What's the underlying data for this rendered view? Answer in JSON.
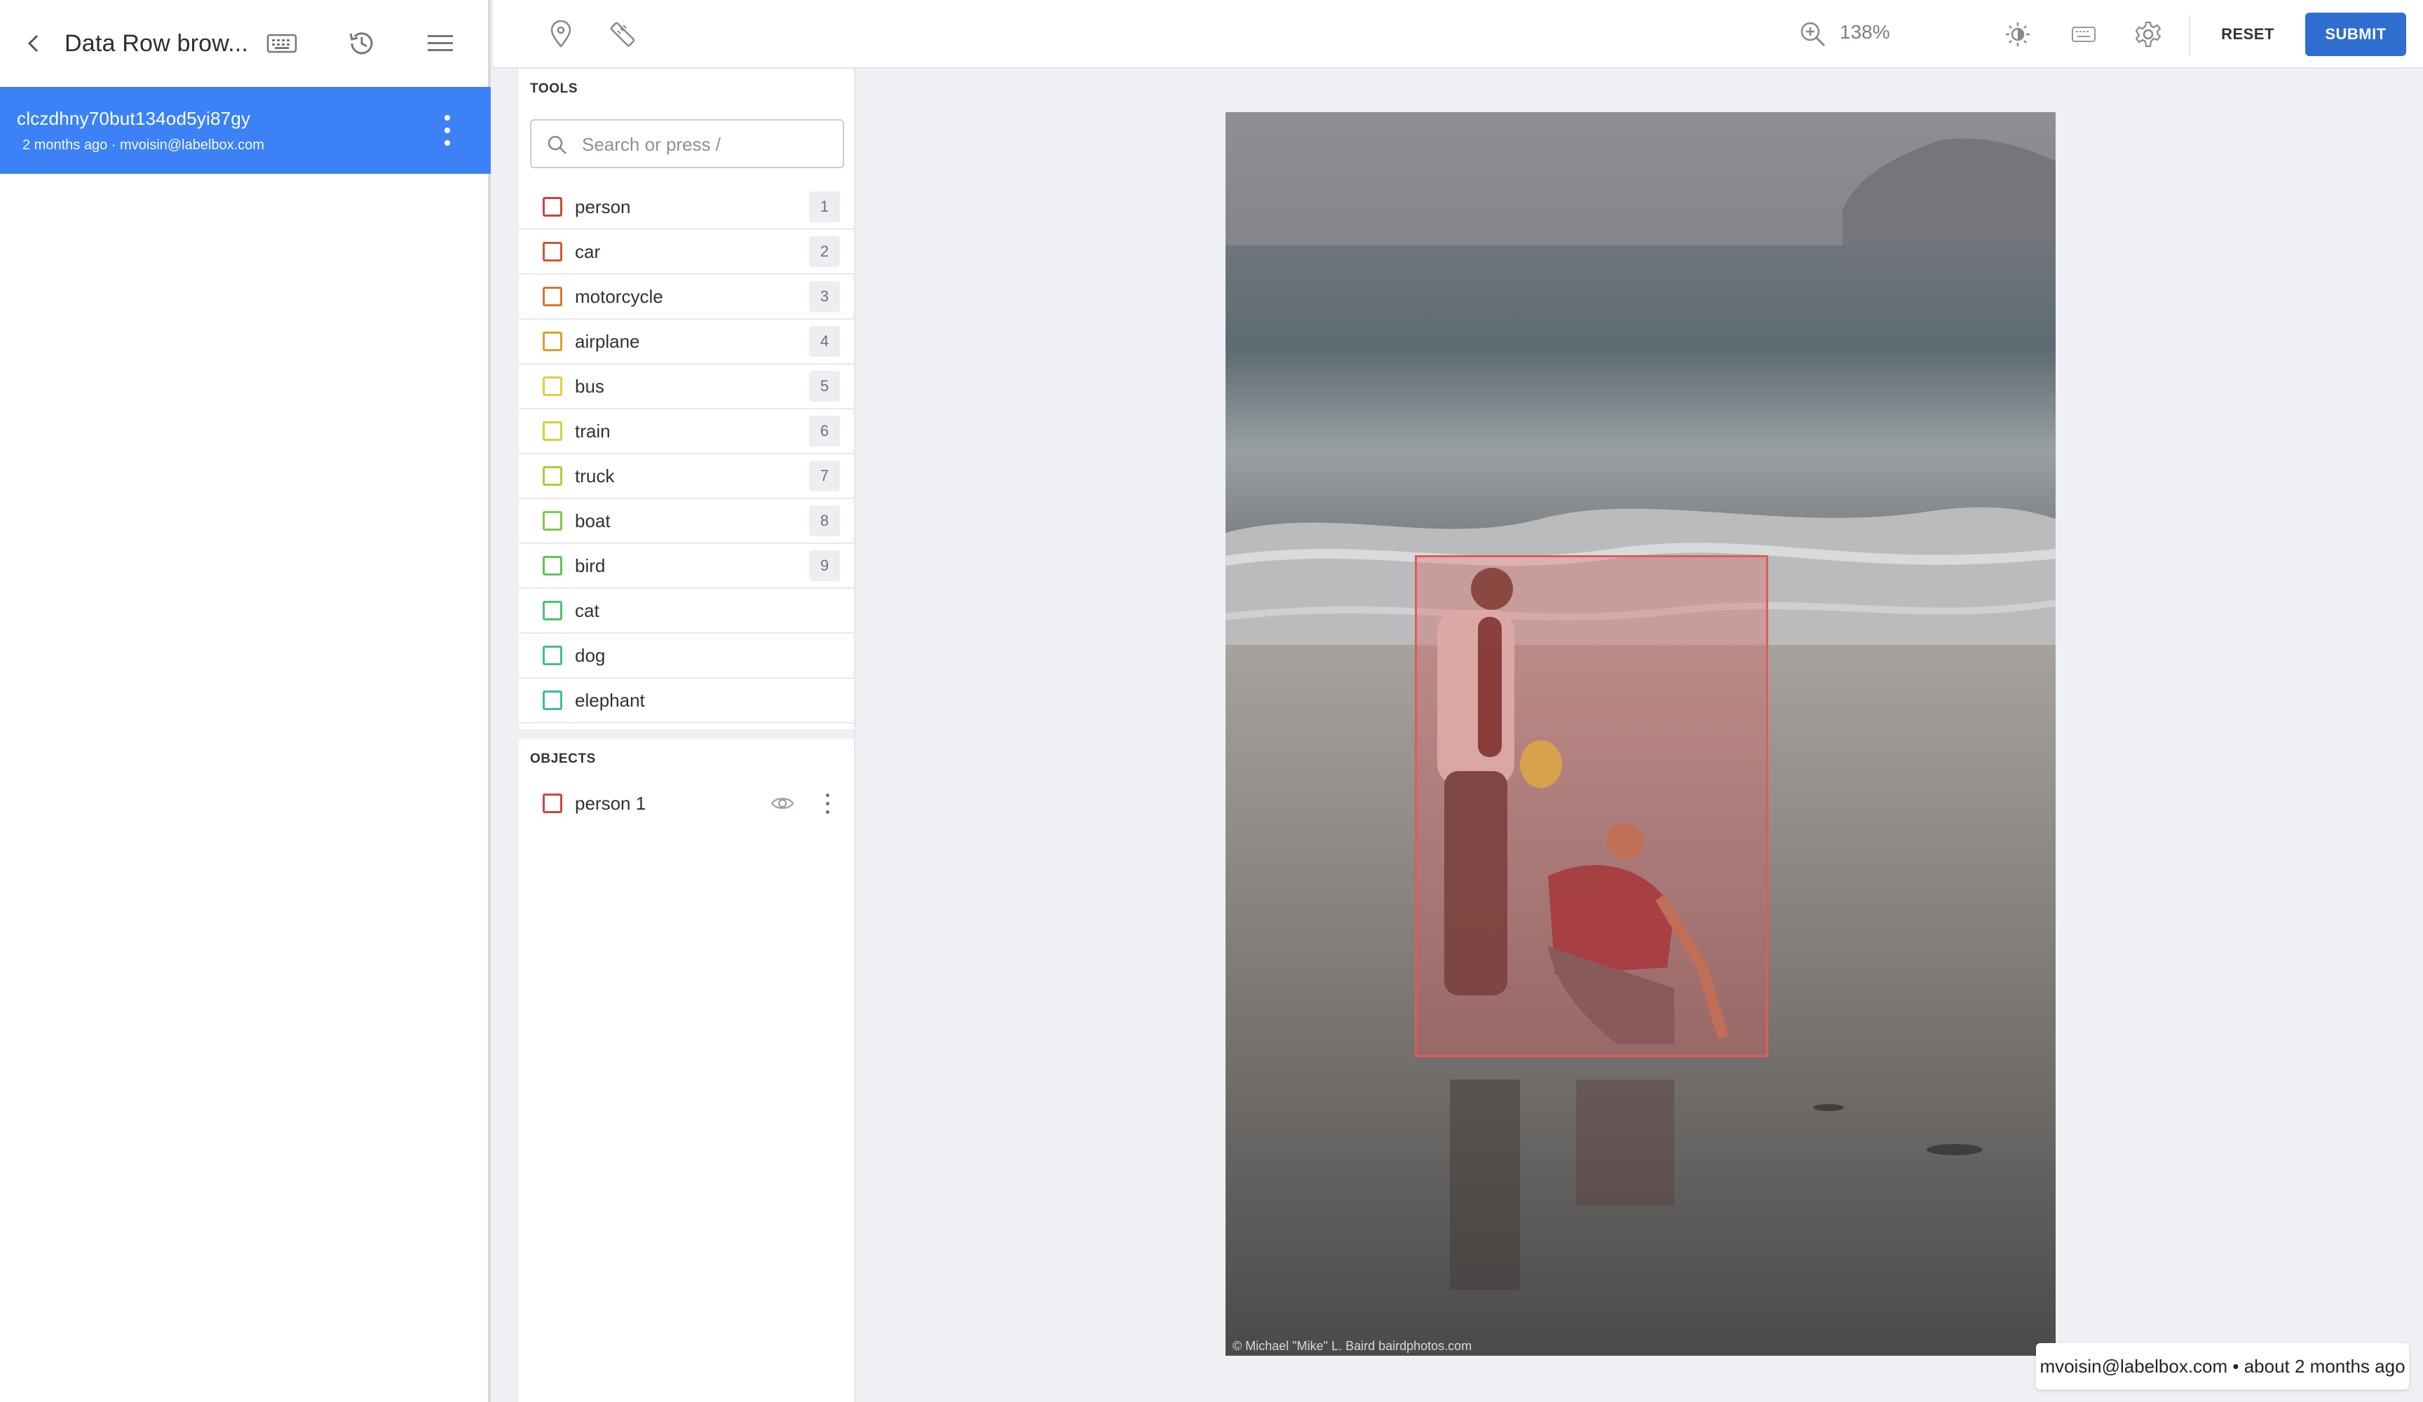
{
  "left_panel": {
    "title": "Data Row brow...",
    "history": {
      "id": "clczdhny70but134od5yi87gy",
      "meta": "2 months ago · mvoisin@labelbox.com"
    }
  },
  "toolbar": {
    "zoom": "138%",
    "reset_label": "RESET",
    "submit_label": "SUBMIT"
  },
  "tools": {
    "section_label": "TOOLS",
    "search_placeholder": "Search or press /",
    "items": [
      {
        "label": "person",
        "key": "1",
        "color": "#c9463b"
      },
      {
        "label": "car",
        "key": "2",
        "color": "#d2552f"
      },
      {
        "label": "motorcycle",
        "key": "3",
        "color": "#d8762c"
      },
      {
        "label": "airplane",
        "key": "4",
        "color": "#d9a02d"
      },
      {
        "label": "bus",
        "key": "5",
        "color": "#e1cf3c"
      },
      {
        "label": "train",
        "key": "6",
        "color": "#c9d43b"
      },
      {
        "label": "truck",
        "key": "7",
        "color": "#a9cf3a"
      },
      {
        "label": "boat",
        "key": "8",
        "color": "#7fc84a"
      },
      {
        "label": "bird",
        "key": "9",
        "color": "#5cc45a"
      },
      {
        "label": "cat",
        "key": "",
        "color": "#4bc36e"
      },
      {
        "label": "dog",
        "key": "",
        "color": "#3fc08a"
      },
      {
        "label": "elephant",
        "key": "",
        "color": "#39bda3"
      }
    ]
  },
  "objects": {
    "section_label": "OBJECTS",
    "items": [
      {
        "label": "person 1",
        "color": "#c9463b"
      }
    ]
  },
  "canvas": {
    "photo_credit": "© Michael \"Mike\" L. Baird bairdphotos.com",
    "status": "mvoisin@labelbox.com • about 2 months ago"
  }
}
